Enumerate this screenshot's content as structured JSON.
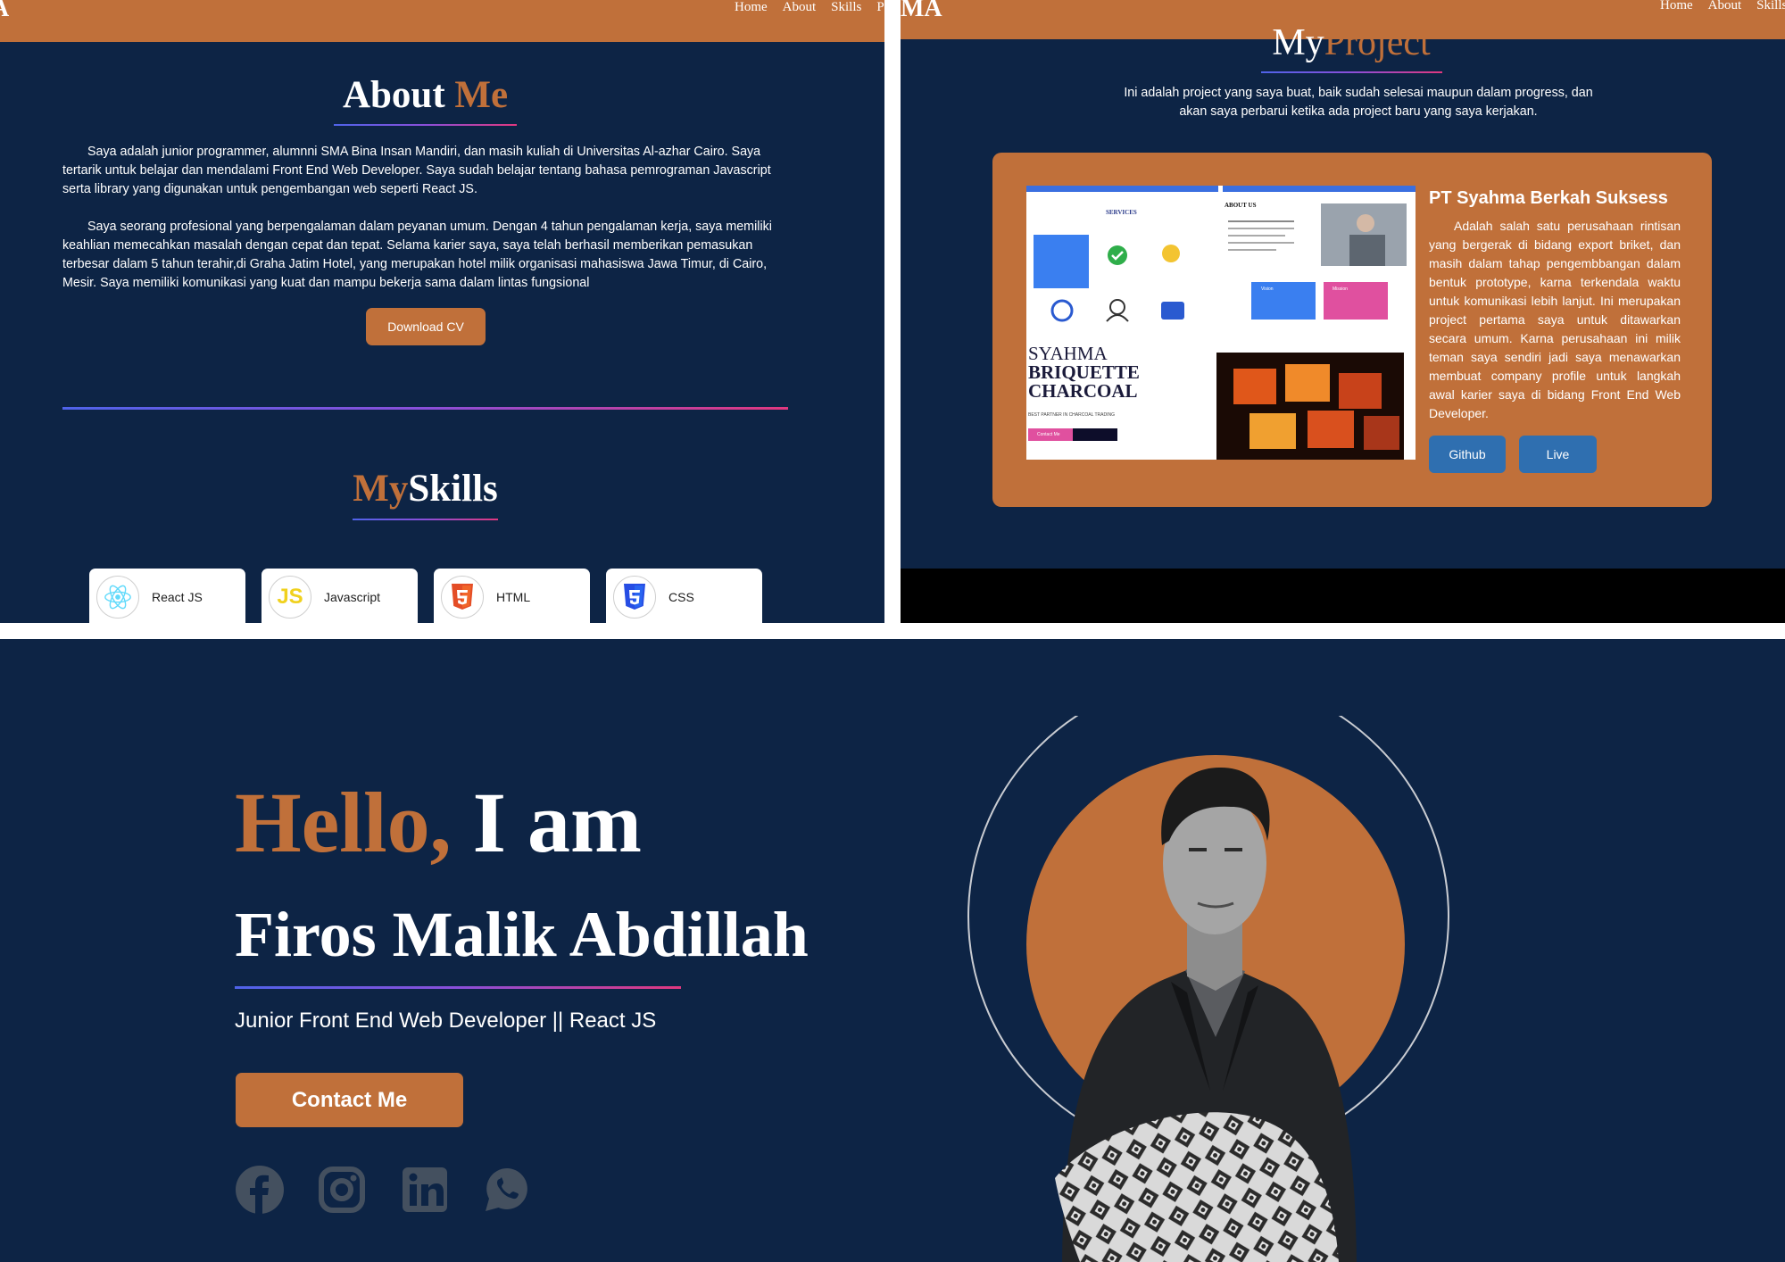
{
  "colors": {
    "navy": "#0d2445",
    "accent": "#c0703a",
    "button_blue": "#2f6fb0"
  },
  "about_panel": {
    "logo": "A",
    "nav": [
      "Home",
      "About",
      "Skills",
      "Proj"
    ],
    "title_white": "About ",
    "title_accent": "Me",
    "para1": "Saya adalah junior programmer, alumnni SMA Bina Insan Mandiri, dan masih kuliah di Universitas Al-azhar Cairo. Saya tertarik untuk belajar dan mendalami Front End Web Developer. Saya sudah belajar tentang bahasa pemrograman Javascript serta library yang digunakan untuk pengembangan web seperti React JS.",
    "para2": "Saya seorang profesional yang berpengalaman dalam peyanan umum. Dengan 4 tahun pengalaman kerja, saya memiliki keahlian memecahkan masalah dengan cepat dan tepat. Selama karier saya, saya telah berhasil memberikan pemasukan terbesar dalam 5 tahun terahir,di Graha Jatim Hotel, yang merupakan hotel milik organisasi mahasiswa Jawa Timur, di Cairo, Mesir. Saya memiliki komunikasi yang kuat dan mampu bekerja sama dalam lintas fungsional",
    "download_btn": "Download CV",
    "skills_title_accent": "My",
    "skills_title_white": "Skills",
    "skills": [
      {
        "name": "React JS",
        "icon": "react-icon"
      },
      {
        "name": "Javascript",
        "icon": "javascript-icon"
      },
      {
        "name": "HTML",
        "icon": "html5-icon"
      },
      {
        "name": "CSS",
        "icon": "css3-icon"
      }
    ]
  },
  "project_panel": {
    "logo": "MA",
    "nav": [
      "Home",
      "About",
      "Skills"
    ],
    "title_white": "My",
    "title_accent": "Project",
    "description": "Ini adalah project yang saya buat, baik sudah selesai maupun dalam progress, dan akan saya perbarui ketika ada project baru yang saya kerjakan.",
    "project": {
      "name": "PT Syahma Berkah Suksess",
      "text": "Adalah salah satu perusahaan rintisan yang bergerak di bidang export briket, dan masih dalam tahap pengembbangan dalam bentuk prototype, karna terkendala waktu untuk komunikasi lebih lanjut. Ini merupakan project pertama saya untuk ditawarkan secara umum. Karna perusahaan ini milik teman saya sendiri jadi saya menawarkan membuat company profile untuk langkah awal karier saya di bidang Front End Web Developer.",
      "github_btn": "Github",
      "live_btn": "Live",
      "screenshot": {
        "services_heading": "SERVICES",
        "about_heading": "ABOUT US",
        "brand_line1": "SYAHMA",
        "brand_line2": "BRIQUETTE",
        "brand_line3": "CHARCOAL",
        "tagline": "BEST PARTNER IN CHARCOAL TRADING",
        "contact_btn": "Contact Me",
        "vision": "Vision",
        "mission": "Mission"
      }
    }
  },
  "hero": {
    "hello_accent": "Hello,",
    "hello_white": " I am",
    "name": "Firos Malik Abdillah",
    "role": "Junior Front End Web Developer || React JS",
    "contact_btn": "Contact Me",
    "socials": [
      "facebook-icon",
      "instagram-icon",
      "linkedin-icon",
      "whatsapp-icon"
    ]
  }
}
